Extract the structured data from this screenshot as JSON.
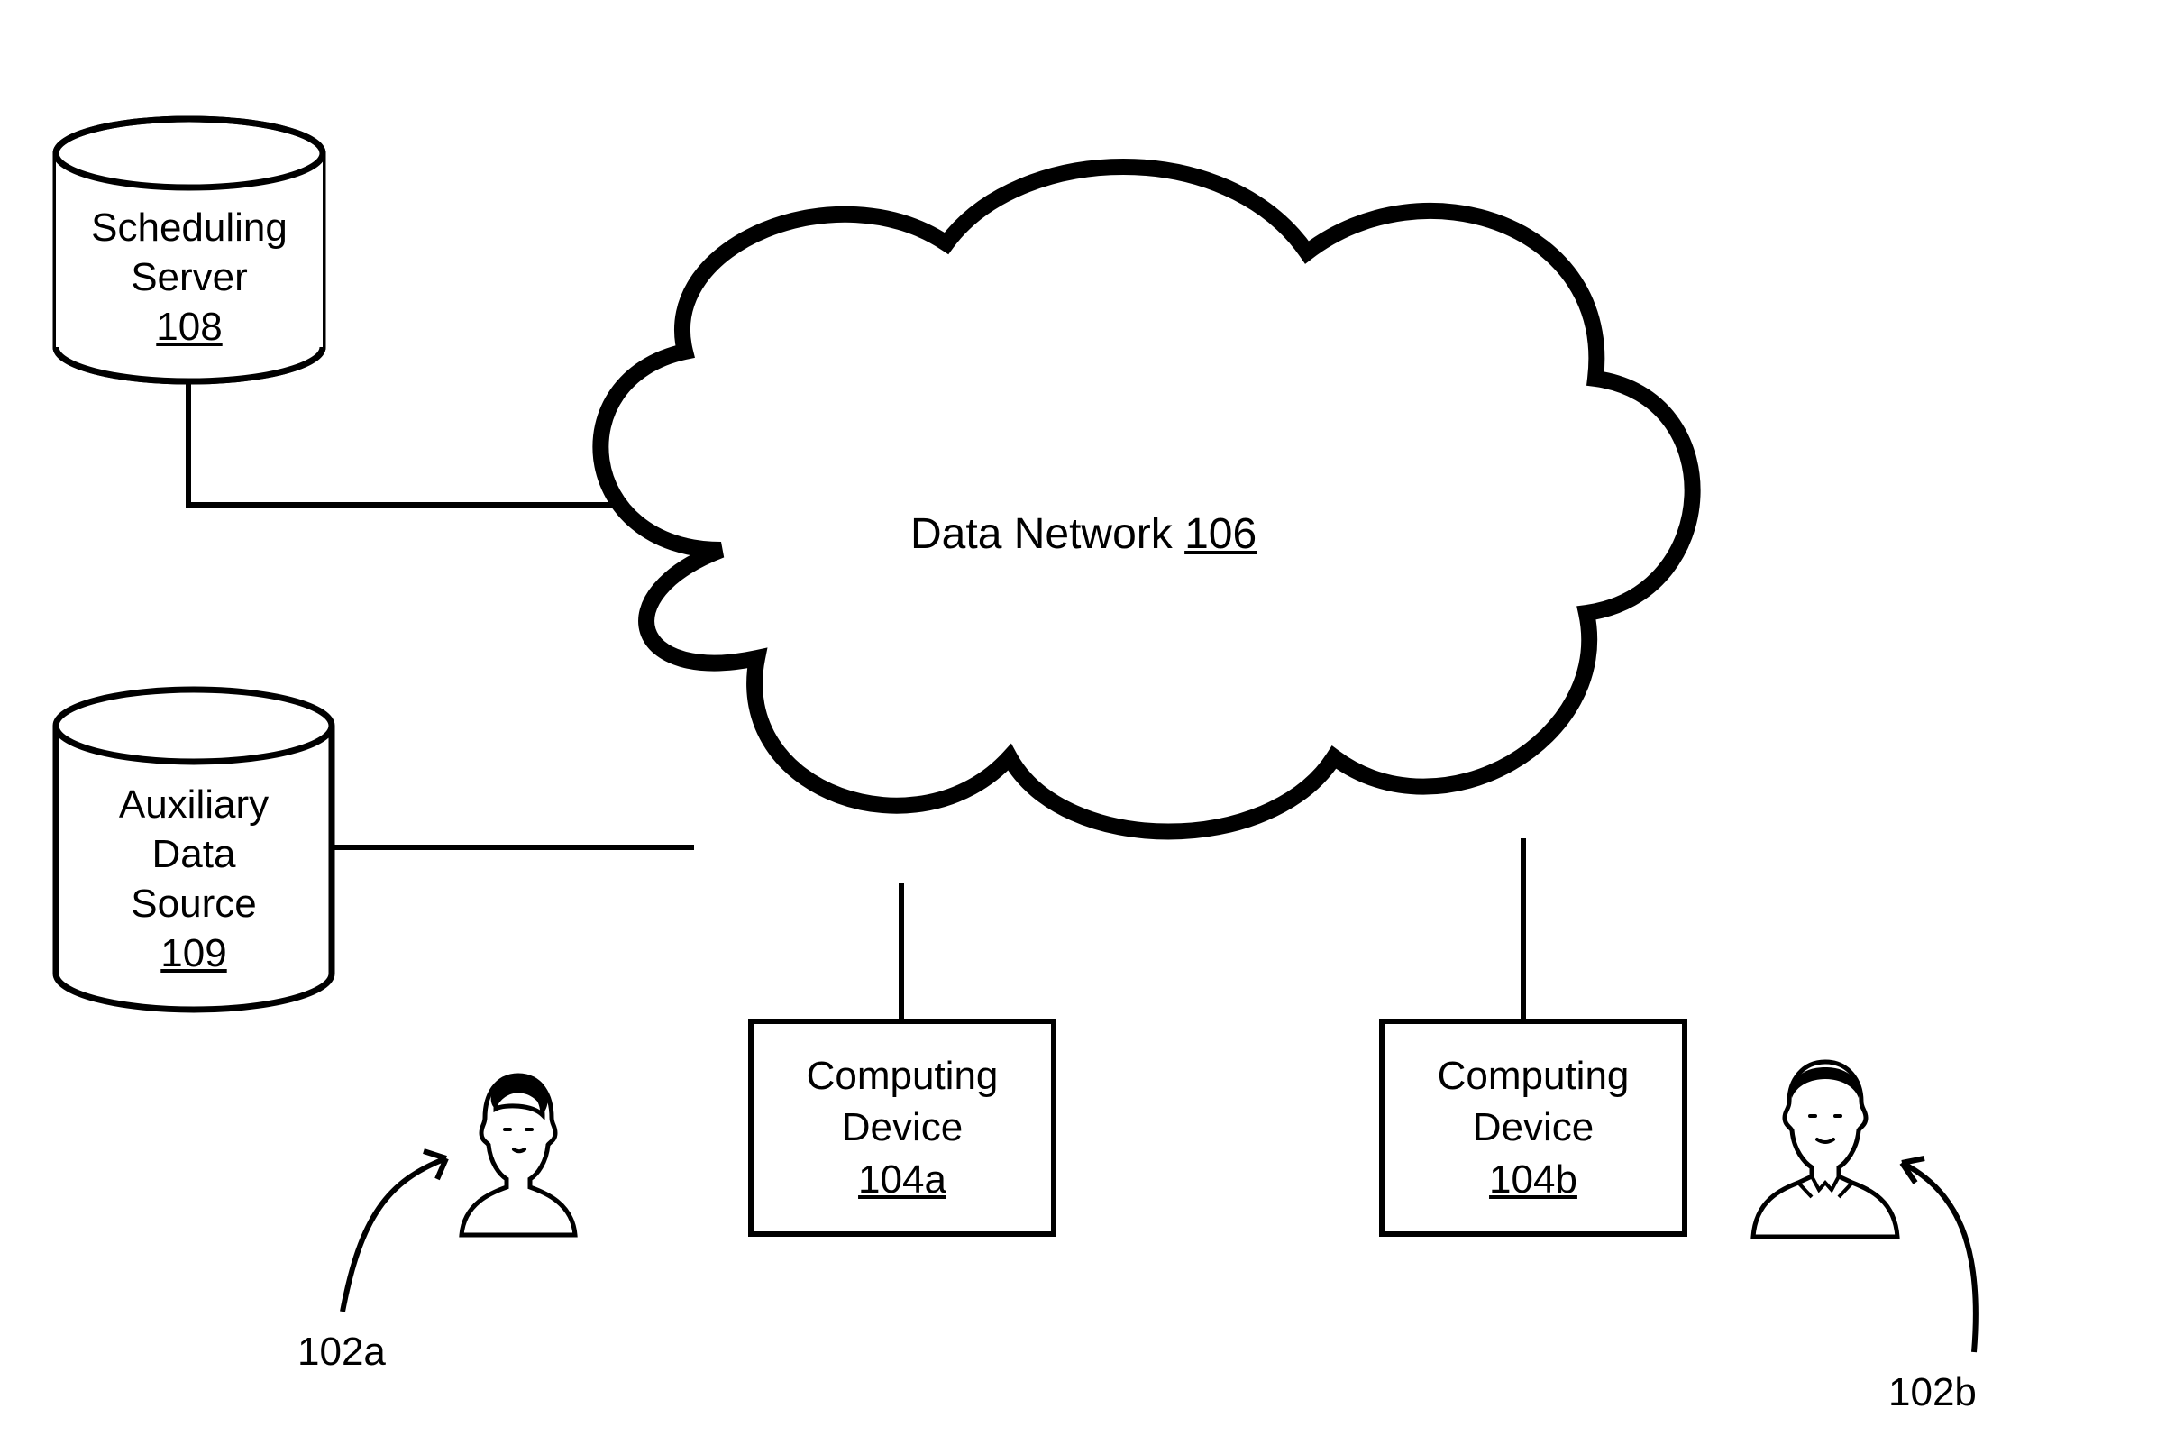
{
  "cloud": {
    "label_prefix": "Data Network ",
    "ref": "106"
  },
  "cylinder1": {
    "line1": "Scheduling",
    "line2": "Server",
    "ref": "108"
  },
  "cylinder2": {
    "line1": "Auxiliary",
    "line2": "Data",
    "line3": "Source",
    "ref": "109"
  },
  "boxA": {
    "line1": "Computing",
    "line2": "Device",
    "ref": "104a"
  },
  "boxB": {
    "line1": "Computing",
    "line2": "Device",
    "ref": "104b"
  },
  "userA_ref": "102a",
  "userB_ref": "102b"
}
